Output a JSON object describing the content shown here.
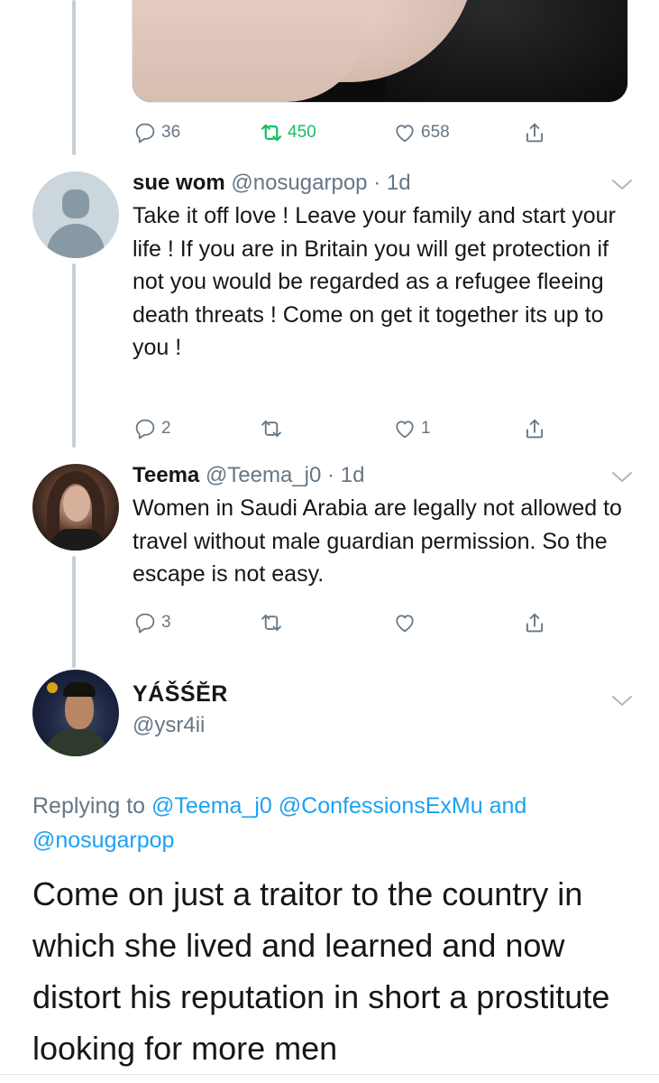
{
  "top_tweet": {
    "actions": {
      "replies": "36",
      "retweets": "450",
      "likes": "658"
    }
  },
  "replies": [
    {
      "name": "sue wom",
      "handle": "@nosugarpop",
      "separator": "·",
      "time": "1d",
      "avatar": "default-avatar",
      "text": "Take it off love ! Leave your family and start your life ! If you are in Britain you will get protection if not you would be regarded as a refugee fleeing death threats ! Come on get it together its up to you !",
      "actions": {
        "replies": "2",
        "retweets": "",
        "likes": "1"
      }
    },
    {
      "name": "Teema",
      "handle": "@Teema_j0",
      "separator": "·",
      "time": "1d",
      "avatar": "photo-avatar",
      "text": "Women in Saudi Arabia are legally not allowed to travel without male guardian permission. So the escape is not easy.",
      "actions": {
        "replies": "3",
        "retweets": "",
        "likes": ""
      }
    }
  ],
  "focal_tweet": {
    "name": "YÁŠŚĔR",
    "handle": "@ysr4ii",
    "replying_prefix": "Replying to",
    "replying_mentions": [
      "@Teema_j0",
      "@ConfessionsExMu"
    ],
    "replying_and": "and",
    "replying_last": "@nosugarpop",
    "text": "Come on just a traitor to the country in which she lived and learned and now distort his reputation in short a prostitute looking for more men"
  },
  "colors": {
    "text": "#14171a",
    "secondary": "#657786",
    "link": "#1da1f2",
    "retweet_active": "#17bf63",
    "thread_line": "#c4cfd6"
  }
}
